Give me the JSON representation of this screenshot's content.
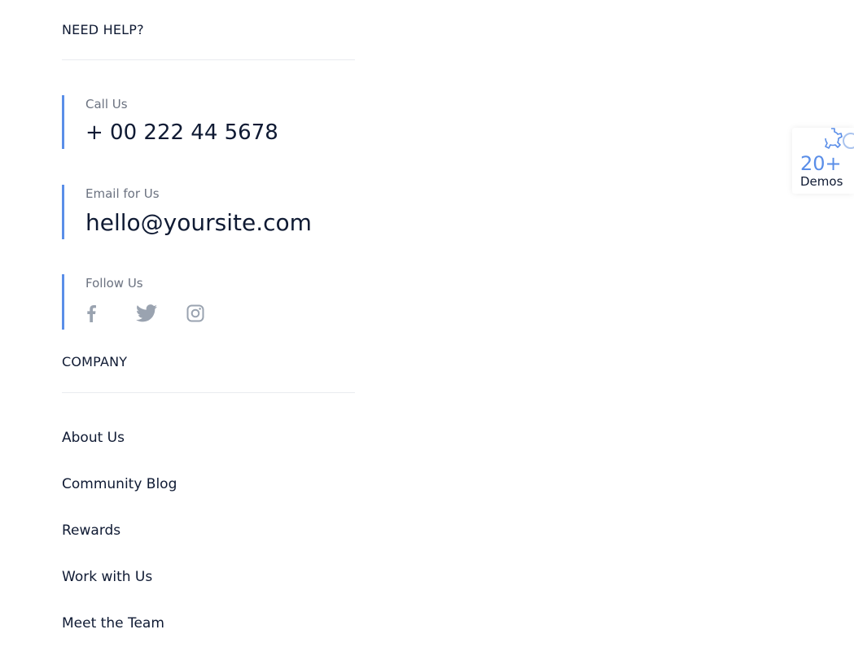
{
  "need_help": {
    "title": "NEED HELP?",
    "call": {
      "label": "Call Us",
      "value": "+ 00 222 44 5678"
    },
    "email": {
      "label": "Email for Us",
      "value": "hello@yoursite.com"
    },
    "follow": {
      "label": "Follow Us",
      "icons": [
        "facebook-icon",
        "twitter-icon",
        "instagram-icon"
      ]
    }
  },
  "company": {
    "title": "COMPANY",
    "links": [
      "About Us",
      "Community Blog",
      "Rewards",
      "Work with Us",
      "Meet the Team"
    ]
  },
  "demos_widget": {
    "count": "20+",
    "label": "Demos"
  },
  "colors": {
    "accent": "#5a8ee8",
    "heading": "#0f1a33",
    "muted": "#6b7280",
    "icon": "#9aa3b0"
  }
}
